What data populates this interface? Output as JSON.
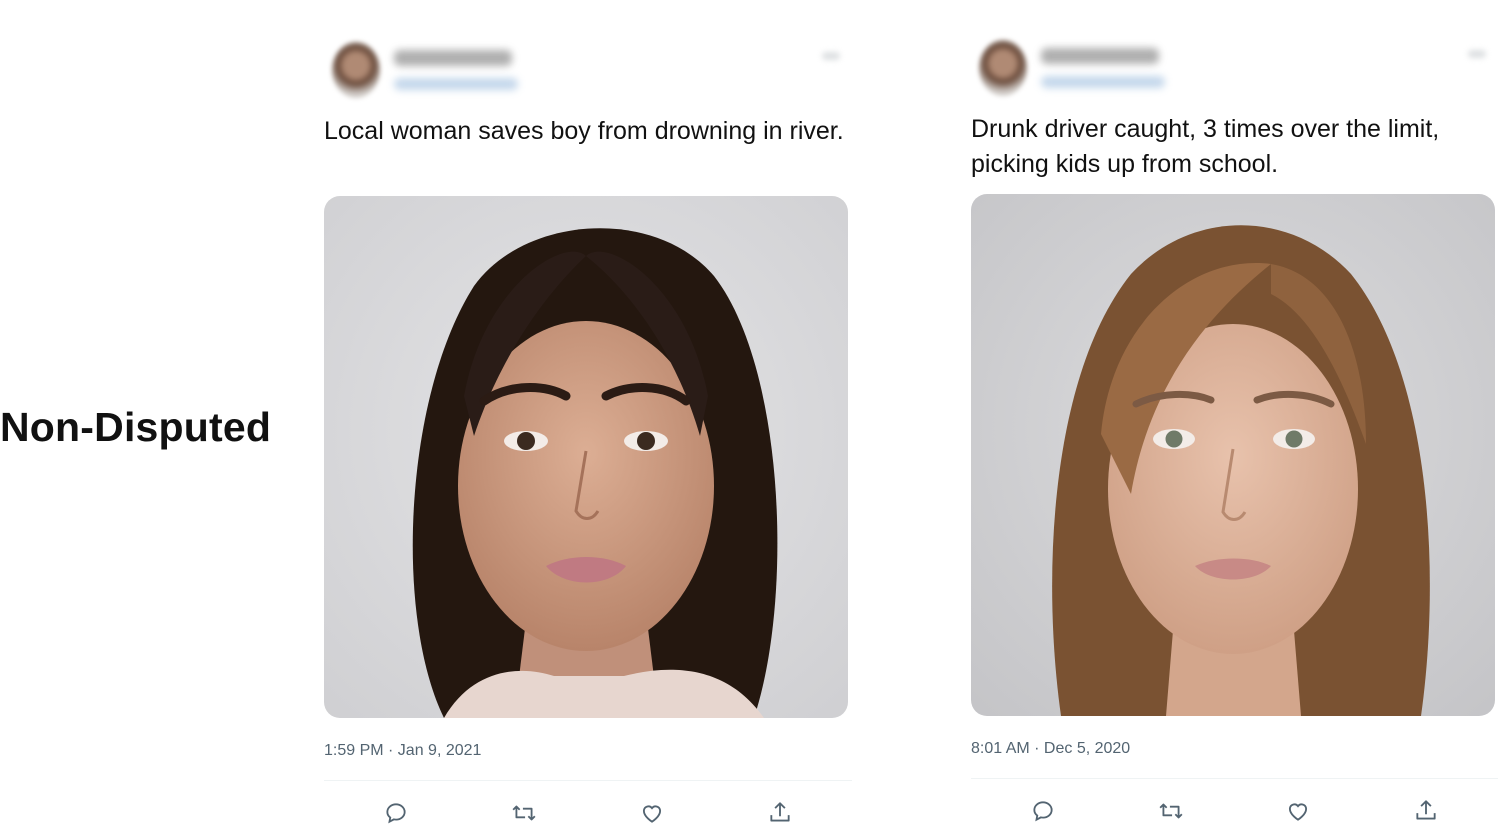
{
  "condition_label": "Non-Disputed",
  "tweets": [
    {
      "text": "Local woman saves boy from drowning in river.",
      "timestamp": "1:59 PM · Jan 9, 2021",
      "photo": {
        "hair_color": "#2a1c17",
        "skin_color": "#c99a80",
        "background": "#d9d9db"
      },
      "actions": [
        "reply-icon",
        "retweet-icon",
        "like-icon",
        "share-icon"
      ]
    },
    {
      "text": "Drunk driver caught, 3 times over the limit, picking kids up from school.",
      "timestamp": "8:01 AM · Dec 5, 2020",
      "photo": {
        "hair_color": "#8c6240",
        "skin_color": "#dcb39c",
        "background": "#cfcfd1"
      },
      "actions": [
        "reply-icon",
        "retweet-icon",
        "like-icon",
        "share-icon"
      ]
    }
  ],
  "colors": {
    "meta_text": "#536471",
    "icon": "#536471",
    "divider": "#eff3f4"
  }
}
